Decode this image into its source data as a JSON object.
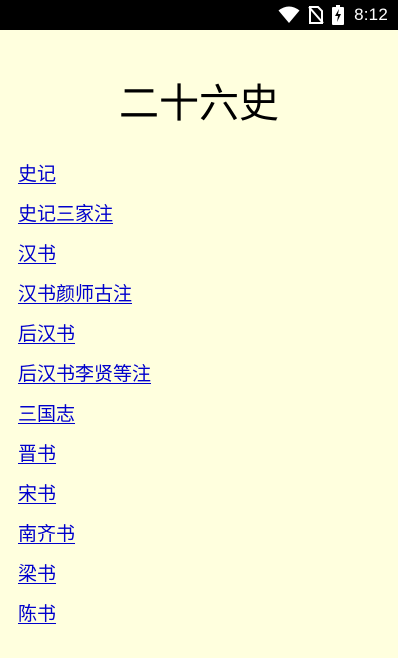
{
  "status_bar": {
    "time": "8:12",
    "icons": [
      "wifi-icon",
      "no-sim-icon",
      "battery-charging-icon"
    ]
  },
  "page": {
    "title": "二十六史",
    "books": [
      {
        "label": "史记"
      },
      {
        "label": "史记三家注"
      },
      {
        "label": "汉书"
      },
      {
        "label": "汉书颜师古注"
      },
      {
        "label": "后汉书"
      },
      {
        "label": "后汉书李贤等注"
      },
      {
        "label": "三国志"
      },
      {
        "label": "晋书"
      },
      {
        "label": "宋书"
      },
      {
        "label": "南齐书"
      },
      {
        "label": "梁书"
      },
      {
        "label": "陈书"
      }
    ]
  },
  "colors": {
    "background": "#ffffde",
    "link": "#0000cc",
    "status_bar": "#000000"
  }
}
